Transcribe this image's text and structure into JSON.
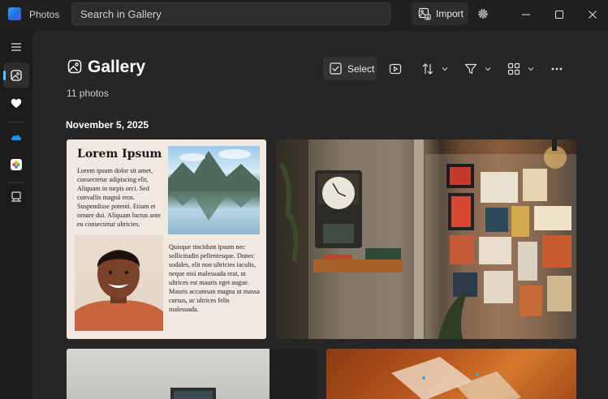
{
  "app": {
    "title": "Photos"
  },
  "search": {
    "placeholder": "Search in Gallery"
  },
  "toolbar": {
    "import_label": "Import",
    "select_label": "Select"
  },
  "gallery": {
    "title": "Gallery",
    "count": "11 photos",
    "date_group": "November 5, 2025"
  },
  "document_photo": {
    "title": "Lorem Ipsum",
    "paragraph1": "Lorem ipsum dolor sit amet, consectetur adipiscing elit, Aliquam in turpis orci. Sed convallis magnā eros. Suspendisse potenti. Etiam et ornare dui. Aliquam luctus ante eu consectetur ultricies.",
    "paragraph2": "Quisque tincidunt ipsum nec sollicitudin pellentesque. Donec sodales, elit non ultricies iaculis, neque nisi malesuada erat, ut ultrices est mauris eget augue. Mauris accumsan magna ut massa cursus, ac ultrices felis malesuada."
  },
  "colors": {
    "accent": "#4cc2ff",
    "background": "#1c1c1c",
    "panel": "#262626"
  }
}
